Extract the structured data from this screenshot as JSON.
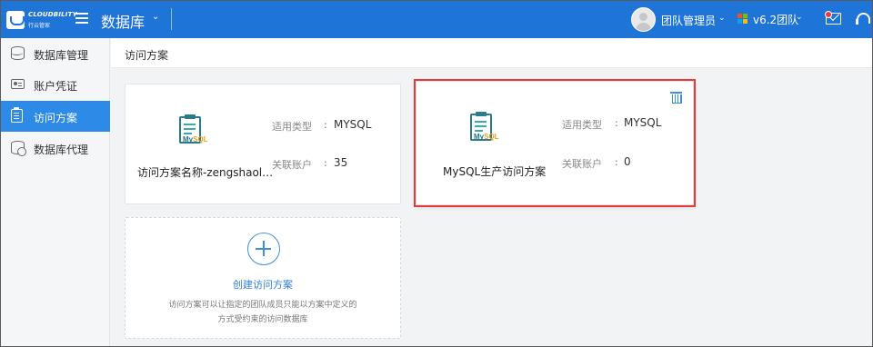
{
  "header": {
    "brand": "CLOUDBILITY",
    "brand_sub": "行云管家",
    "app_title": "数据库",
    "user_name": "团队管理员",
    "team_name": "v6.2团队",
    "colors": {
      "primary": "#1f74d8",
      "badge": "#e63b3b"
    }
  },
  "sidebar": {
    "items": [
      {
        "label": "数据库管理",
        "icon": "database-icon",
        "active": false
      },
      {
        "label": "账户凭证",
        "icon": "id-card-icon",
        "active": false
      },
      {
        "label": "访问方案",
        "icon": "clipboard-icon",
        "active": true
      },
      {
        "label": "数据库代理",
        "icon": "database-proxy-icon",
        "active": false
      }
    ]
  },
  "breadcrumb": {
    "title": "访问方案"
  },
  "plans": [
    {
      "name": "访问方案名称-zengshaol…",
      "type_label": "适用类型",
      "type_value": "MYSQL",
      "accounts_label": "关联账户",
      "accounts_value": "35",
      "colon": ":"
    },
    {
      "name": "MySQL生产访问方案",
      "type_label": "适用类型",
      "type_value": "MYSQL",
      "accounts_label": "关联账户",
      "accounts_value": "0",
      "colon": ":"
    }
  ],
  "icon_text": {
    "my": "My",
    "sql": "SQL"
  },
  "add_card": {
    "title": "创建访问方案",
    "desc_line1": "访问方案可以让指定的团队成员只能以方案中定义的",
    "desc_line2": "方式受约束的访问数据库"
  }
}
